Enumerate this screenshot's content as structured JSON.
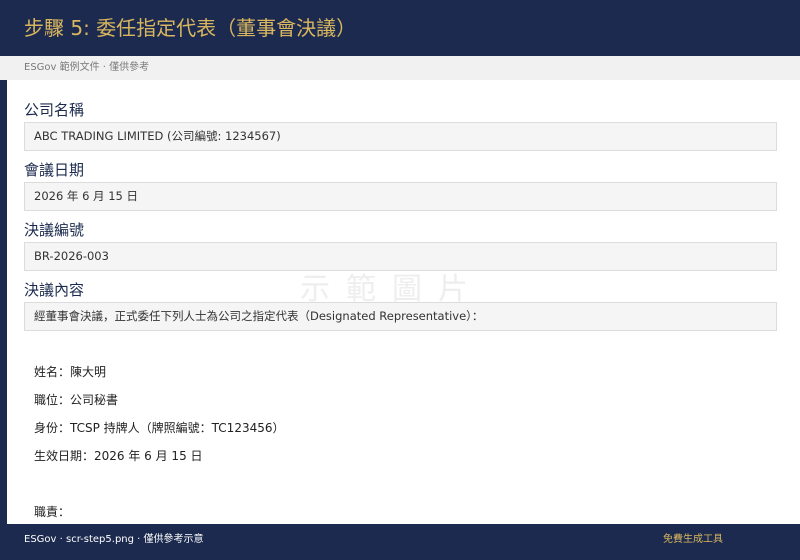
{
  "header": {
    "title": "步驟 5: 委任指定代表（董事會決議）"
  },
  "subheader": {
    "text": "ESGov 範例文件 · 僅供參考"
  },
  "watermark": {
    "text": "示範圖片"
  },
  "fields": {
    "company_name": {
      "label": "公司名稱",
      "value": "ABC TRADING LIMITED (公司編號: 1234567)"
    },
    "meeting_date": {
      "label": "會議日期",
      "value": "2026 年 6 月 15 日"
    },
    "resolution_no": {
      "label": "決議編號",
      "value": "BR-2026-003"
    },
    "resolution_content": {
      "label": "決議內容",
      "value": "經董事會決議，正式委任下列人士為公司之指定代表（Designated Representative）："
    }
  },
  "details": {
    "name": "姓名：陳大明",
    "position": "職位：公司秘書",
    "identity": "身份：TCSP 持牌人（牌照編號：TC123456）",
    "effective_date": "生效日期：2026 年 6 月 15 日",
    "duties": "職責："
  },
  "footer": {
    "left_text": "ESGov · scr-step5.png · 僅供參考示意",
    "right_icon": "",
    "right_text": "免費生成工具"
  }
}
